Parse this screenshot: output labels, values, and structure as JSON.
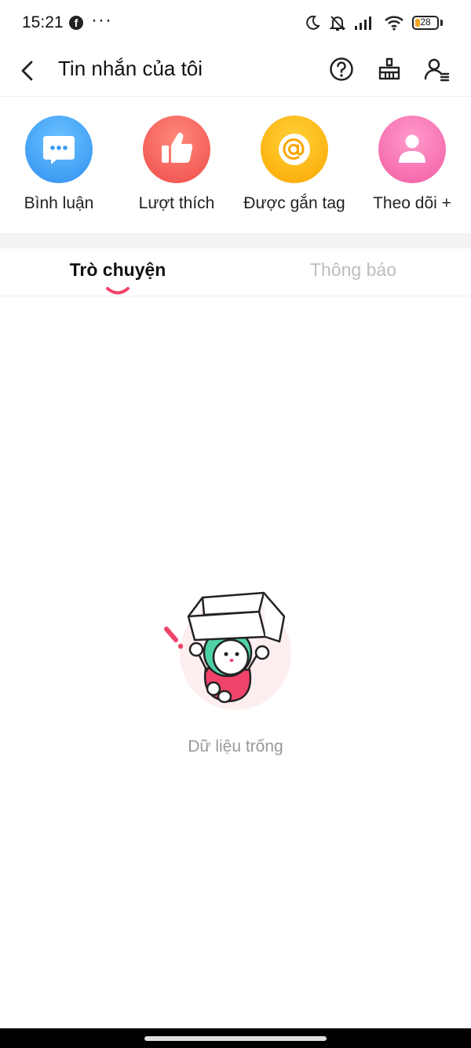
{
  "status_bar": {
    "time": "15:21",
    "notification_icons": [
      "facebook-icon",
      "more-dots-icon"
    ],
    "status_icons": [
      "moon-icon",
      "bell-off-icon",
      "signal-icon",
      "wifi-icon",
      "battery-icon"
    ],
    "battery_level": "28",
    "dots": "···",
    "fb_letter": "f"
  },
  "header": {
    "title": "Tin nhắn của tôi",
    "icons": [
      "back-arrow-icon",
      "help-icon",
      "clear-broom-icon",
      "user-settings-icon"
    ]
  },
  "categories": [
    {
      "label": "Bình luận",
      "icon": "chat-bubble-icon",
      "color": "#3a9bf5"
    },
    {
      "label": "Lượt thích",
      "icon": "thumbs-up-icon",
      "color": "#f05555"
    },
    {
      "label": "Được gắn tag",
      "icon": "at-sign-icon",
      "color": "#fcb10a"
    },
    {
      "label": "Theo dõi +",
      "icon": "person-icon",
      "color": "#f46aae"
    }
  ],
  "tabs": [
    {
      "label": "Trò chuyện",
      "active": true
    },
    {
      "label": "Thông báo",
      "active": false
    }
  ],
  "accent_color": "#f0436a",
  "empty_state": {
    "text": "Dữ liệu trống",
    "illustration": "girl-with-box-illustration"
  }
}
